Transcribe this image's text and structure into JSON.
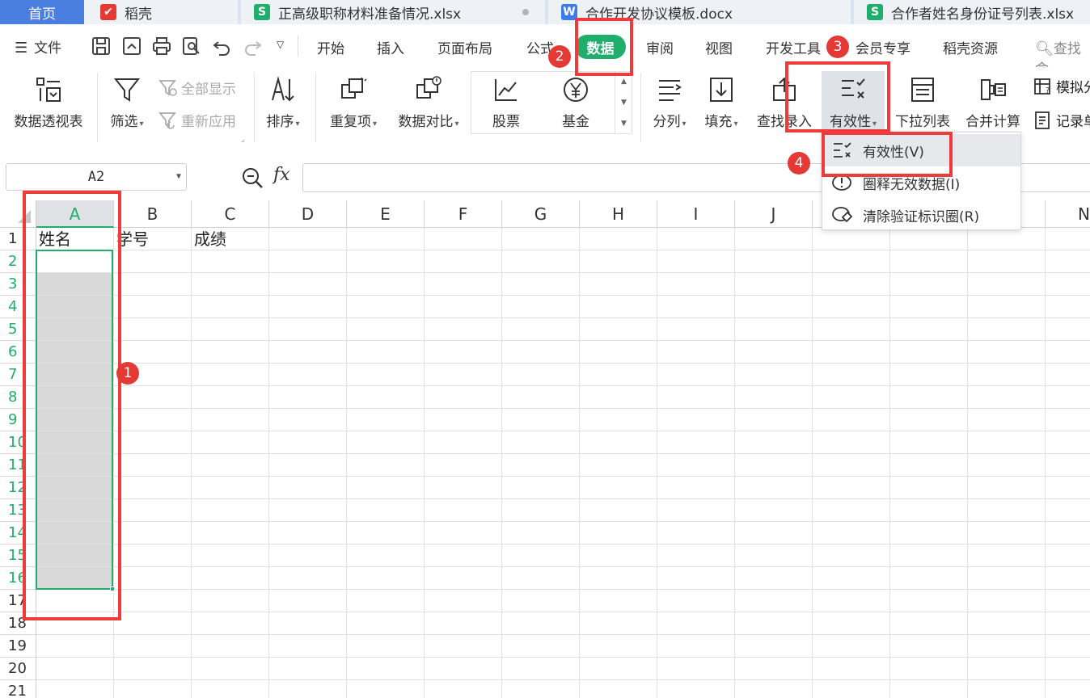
{
  "tabs": [
    {
      "label": "首页"
    },
    {
      "label": "稻壳"
    },
    {
      "label": "正高级职称材料准备情况.xlsx"
    },
    {
      "label": "合作开发协议模板.docx"
    },
    {
      "label": "合作者姓名身份证号列表.xlsx"
    }
  ],
  "menu": {
    "file": "文件",
    "items": [
      "开始",
      "插入",
      "页面布局",
      "公式",
      "数据",
      "审阅",
      "视图",
      "开发工具",
      "会员专享",
      "稻壳资源"
    ],
    "search": "查找命"
  },
  "ribbon": {
    "pivot": "数据透视表",
    "filter": "筛选",
    "show_all": "全部显示",
    "reapply": "重新应用",
    "sort": "排序",
    "duplicates": "重复项",
    "compare": "数据对比",
    "stock": "股票",
    "fund": "基金",
    "split": "分列",
    "fill": "填充",
    "lookup": "查找录入",
    "validity": "有效性",
    "dropdown_list": "下拉列表",
    "consolidate": "合并计算",
    "simulate": "模拟分",
    "record": "记录单"
  },
  "formula_bar": {
    "cell_ref": "A2",
    "fx": "fx",
    "value": ""
  },
  "columns": [
    "A",
    "B",
    "C",
    "D",
    "E",
    "F",
    "G",
    "H",
    "I",
    "J",
    "",
    "",
    "",
    "N"
  ],
  "rows": [
    "1",
    "2",
    "3",
    "4",
    "5",
    "6",
    "7",
    "8",
    "9",
    "10",
    "11",
    "12",
    "13",
    "14",
    "15",
    "16",
    "17",
    "18",
    "19",
    "20",
    "21"
  ],
  "cells": {
    "A1": "姓名",
    "B1": "学号",
    "C1": "成绩"
  },
  "dropdown": {
    "items": [
      "有效性(V)",
      "圈释无效数据(I)",
      "清除验证标识圈(R)"
    ]
  },
  "badges": [
    "1",
    "2",
    "3",
    "4"
  ],
  "colors": {
    "accent": "#1fae6c",
    "annotation": "#ee3b3b",
    "tab_active": "#4a7fe0"
  }
}
